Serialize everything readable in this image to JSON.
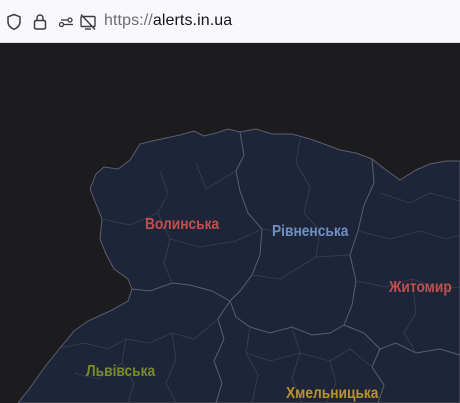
{
  "browser": {
    "url_scheme": "https://",
    "url_host": "alerts.in.ua",
    "icons": [
      "shield-icon",
      "lock-icon",
      "permissions-icon",
      "screen-share-blocked-icon"
    ]
  },
  "map": {
    "regions": [
      {
        "name": "Волинська",
        "color": "#c0504d"
      },
      {
        "name": "Рівненська",
        "color": "#6f8fc4"
      },
      {
        "name": "Житомир",
        "color": "#c0504d"
      },
      {
        "name": "Львівська",
        "color": "#7a8a2e"
      },
      {
        "name": "Хмельницька",
        "color": "#b8922e"
      }
    ]
  },
  "colors": {
    "map_background": "#1c1c1e",
    "region_fill": "#1e2538",
    "region_border": "#5a5f6e"
  }
}
